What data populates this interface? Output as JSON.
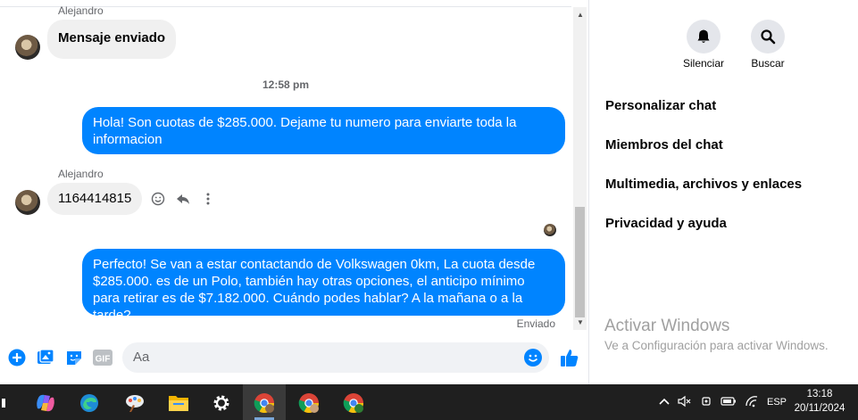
{
  "chat": {
    "messages": [
      {
        "sender": "Alejandro",
        "text": "Mensaje enviado"
      },
      {
        "text": "Hola! Son cuotas de $285.000. Dejame tu numero para enviarte toda la informacion"
      },
      {
        "sender": "Alejandro",
        "text": "1164414815"
      },
      {
        "text": "Perfecto!  Se van a estar contactando de Volkswagen 0km, La cuota desde $285.000. es de un Polo, también hay otras opciones, el anticipo mínimo para retirar es de $7.182.000. Cuándo podes hablar? A la mañana o a la tarde?"
      }
    ],
    "timestamp": "12:58 pm",
    "delivery_status": "Enviado"
  },
  "composer": {
    "placeholder": "Aa",
    "gif_label": "GIF"
  },
  "side_panel": {
    "mute_label": "Silenciar",
    "search_label": "Buscar",
    "menu": [
      "Personalizar chat",
      "Miembros del chat",
      "Multimedia, archivos y enlaces",
      "Privacidad y ayuda"
    ],
    "activate_title": "Activar Windows",
    "activate_subtitle": "Ve a Configuración para activar Windows."
  },
  "taskbar": {
    "language": "ESP",
    "time": "13:18",
    "date": "20/11/2024"
  },
  "colors": {
    "messenger_blue": "#0084ff",
    "incoming_bubble": "#f0f0f0",
    "taskbar": "#1f1f1f"
  }
}
